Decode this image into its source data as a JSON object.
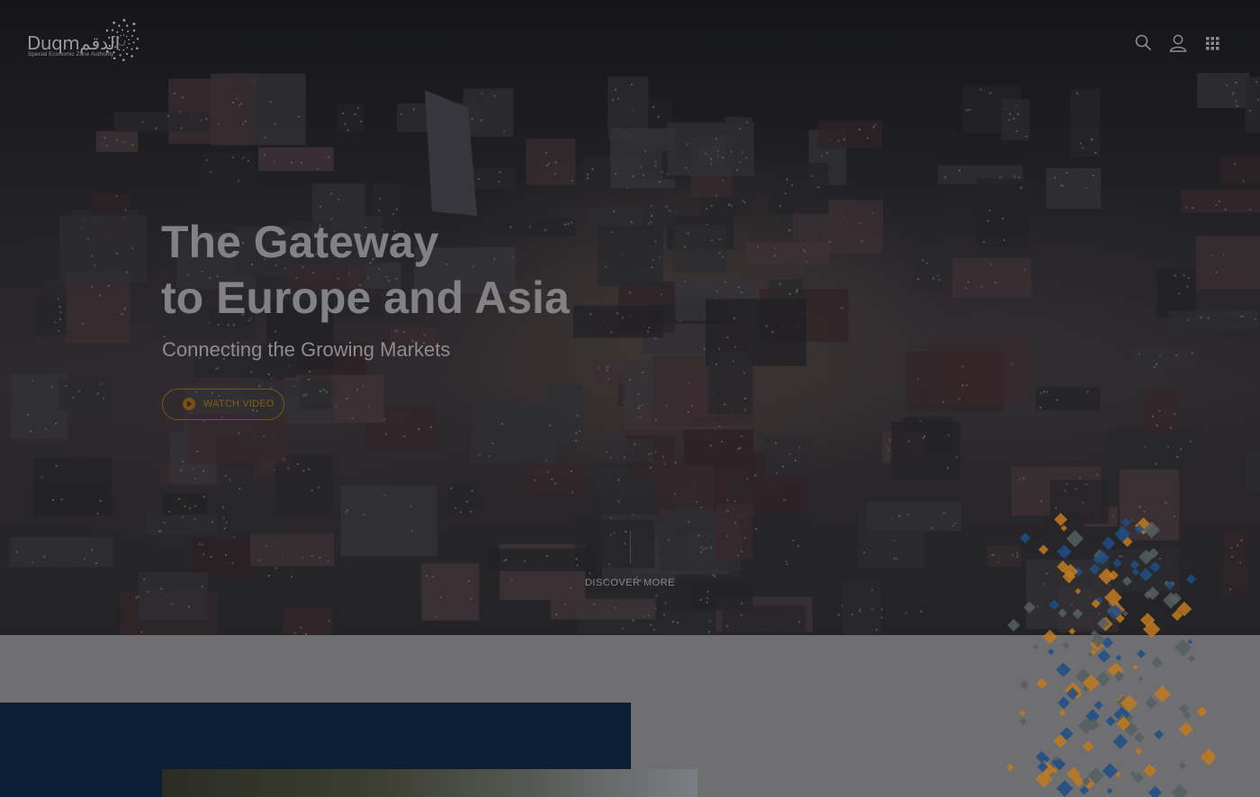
{
  "header": {
    "logo": {
      "name_latin": "Duqm",
      "name_arabic": "الدقم",
      "tagline": "Special Economic Zone Authority"
    },
    "icons": [
      "search-icon",
      "user-icon",
      "apps-grid-icon"
    ]
  },
  "hero": {
    "title_line1": "The Gateway",
    "title_line2": "to Europe and Asia",
    "subtitle": "Connecting the Growing Markets",
    "watch_video_label": "WATCH VIDEO",
    "discover_more_label": "DISCOVER MORE"
  },
  "colors": {
    "accent_orange": "#8c5b15",
    "navy": "#0c1f34",
    "pattern_orange": "#c27a1e",
    "pattern_blue": "#1e4f86",
    "pattern_gray": "#556062"
  }
}
